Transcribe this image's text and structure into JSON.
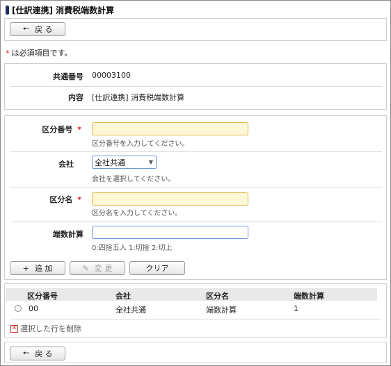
{
  "page": {
    "title": "[仕訳連携] 消費税端数計算"
  },
  "nav": {
    "back_label": "戻 る",
    "back_icon": "arrow-left-icon"
  },
  "required_note": {
    "mark": "*",
    "text": "は必須項目です。"
  },
  "info": {
    "common_no_label": "共通番号",
    "common_no_value": "00003100",
    "content_label": "内容",
    "content_value": "[仕訳連携] 消費税端数計算"
  },
  "form": {
    "category_no": {
      "label": "区分番号",
      "required_mark": "*",
      "value": "",
      "hint": "区分番号を入力してください。"
    },
    "company": {
      "label": "会社",
      "selected": "全社共通",
      "hint": "会社を選択してください。"
    },
    "category_name": {
      "label": "区分名",
      "required_mark": "*",
      "value": "",
      "hint": "区分名を入力してください。"
    },
    "rounding": {
      "label": "端数計算",
      "value": "",
      "hint": "0:四捨五入 1:切捨 2:切上"
    }
  },
  "actions": {
    "add_label": "追 加",
    "change_label": "変 更",
    "clear_label": "クリア"
  },
  "table": {
    "columns": [
      "区分番号",
      "会社",
      "区分名",
      "端数計算"
    ],
    "rows": [
      {
        "category_no": "00",
        "company": "全社共通",
        "category_name": "端数計算",
        "rounding": "1"
      }
    ]
  },
  "delete_selected": {
    "label": "選択した行を削除"
  }
}
